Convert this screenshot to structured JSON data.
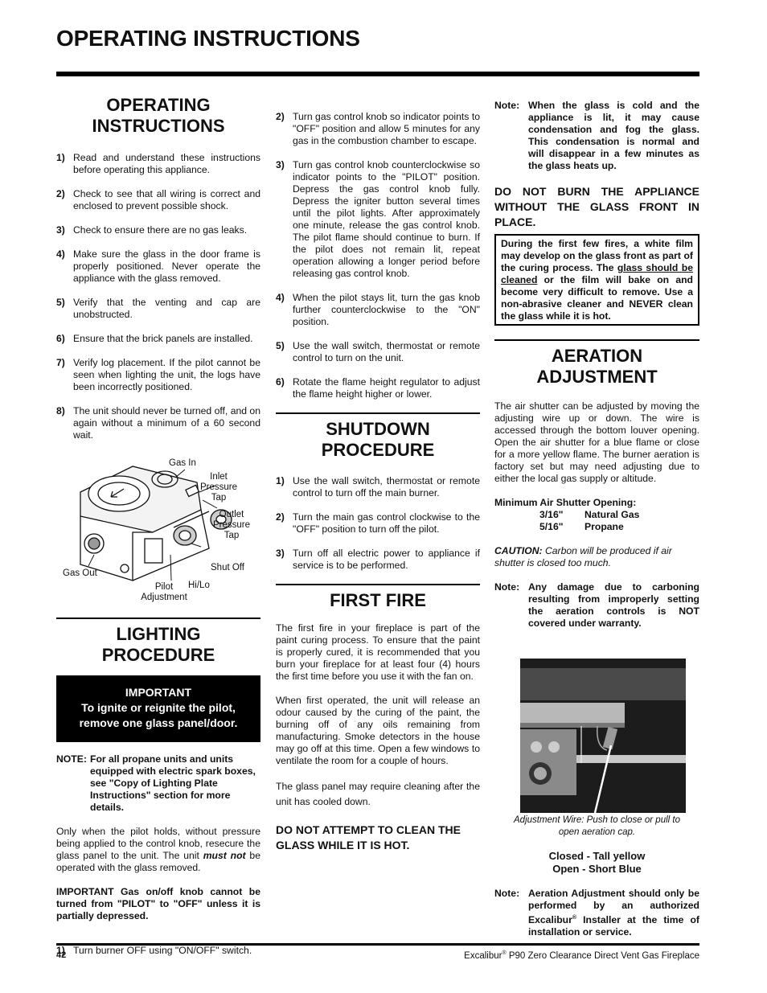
{
  "header": {
    "title": "OPERATING INSTRUCTIONS"
  },
  "operating": {
    "heading_line1": "OPERATING",
    "heading_line2": "INSTRUCTIONS",
    "items": [
      {
        "num": "1)",
        "text": "Read and understand these instructions before operating this appliance."
      },
      {
        "num": "2)",
        "text": "Check to see that all wiring is correct and enclosed to prevent possible shock."
      },
      {
        "num": "3)",
        "text": "Check to ensure there are no gas leaks."
      },
      {
        "num": "4)",
        "text": "Make sure the glass in the door frame is properly positioned. Never operate the appliance with the glass removed."
      },
      {
        "num": "5)",
        "text": "Verify that the venting and cap are unobstructed."
      },
      {
        "num": "6)",
        "text": "Ensure that the brick panels are installed."
      },
      {
        "num": "7)",
        "text": "Verify log placement. If the pilot cannot be seen when lighting the unit, the logs have been incorrectly positioned."
      },
      {
        "num": "8)",
        "text": "The unit should never be turned off, and on again without a minimum of a 60 second wait."
      }
    ]
  },
  "valve_diagram": {
    "labels": {
      "gas_in": "Gas In",
      "inlet_pressure_tap": "Inlet Pressure Tap",
      "outlet_pressure_tap": "Outlet Pressure Tap",
      "shut_off": "Shut Off",
      "gas_out": "Gas Out",
      "hi_lo": "Hi/Lo",
      "pilot_adjustment": "Pilot Adjustment"
    }
  },
  "lighting": {
    "heading_line1": "LIGHTING",
    "heading_line2": "PROCEDURE",
    "important_title": "IMPORTANT",
    "important_line1": "To ignite or reignite the pilot,",
    "important_line2": "remove one glass panel/door.",
    "note_label": "NOTE:",
    "note_text": "For all propane units and units equipped with electric spark boxes, see \"Copy of Lighting Plate Instructions\" section for more details.",
    "para1_a": "Only when the pilot holds, without pressure being applied to the control knob, resecure the glass panel to the unit. The unit ",
    "para1_em": "must not",
    "para1_b": " be operated with the glass removed.",
    "important_para": "IMPORTANT Gas on/off knob cannot be turned from \"PILOT\" to \"OFF\" unless it is partially depressed.",
    "items": [
      {
        "num": "1)",
        "text": "Turn burner OFF using \"ON/OFF\" switch."
      },
      {
        "num": "2)",
        "text": "Turn gas control knob so indicator points to \"OFF\" position and allow 5 minutes for any gas in the combustion chamber to escape."
      },
      {
        "num": "3)",
        "text": "Turn gas control knob counterclockwise so indicator points to the \"PILOT\" position. Depress the gas control knob fully. Depress the igniter button several times until the pilot lights. After approximately one minute, release the gas control knob. The pilot flame should continue to burn. If the pilot does not remain lit, repeat operation allowing a longer period before releasing gas control knob."
      },
      {
        "num": "4)",
        "text": "When the pilot stays lit, turn the gas knob further counterclockwise to the \"ON\" position."
      },
      {
        "num": "5)",
        "text": "Use the wall switch, thermostat or remote control to turn on the unit."
      },
      {
        "num": "6)",
        "text": "Rotate the flame height regulator to adjust the flame height higher or lower."
      }
    ]
  },
  "shutdown": {
    "heading_line1": "SHUTDOWN",
    "heading_line2": "PROCEDURE",
    "items": [
      {
        "num": "1)",
        "text": "Use the wall switch, thermostat or remote control to turn off the main burner."
      },
      {
        "num": "2)",
        "text": "Turn the main gas control clockwise to the \"OFF\" position to turn off the pilot."
      },
      {
        "num": "3)",
        "text": "Turn off all electric power to appliance if service is to be performed."
      }
    ]
  },
  "first_fire": {
    "heading": "FIRST FIRE",
    "para1": "The first fire in your fireplace is part of the paint curing process. To ensure that the paint is properly cured, it is recommended that you burn your fireplace for at least four (4) hours the first time before you use it with the fan on.",
    "para2": "When first operated, the unit will release an odour caused by the curing of the paint, the burning off of any oils remaining from manufacturing. Smoke detectors in the house may go off at this time. Open a few windows to ventilate the room for a couple of hours.",
    "para3": "The glass panel may require cleaning after the unit has cooled down.",
    "warning": "DO NOT ATTEMPT TO CLEAN THE GLASS WHILE IT IS HOT.",
    "note_label": "Note:",
    "note_text": "When the glass is cold and the appliance is lit, it may cause condensation and fog the glass. This condensation is normal and will disappear in a few minutes as the glass heats up.",
    "warning2": "DO NOT BURN THE APPLIANCE WITHOUT THE GLASS FRONT IN PLACE.",
    "box_a": "During the first few fires, a white film may develop on the glass front as part of the curing process. The ",
    "box_u": "glass should be cleaned",
    "box_b": " or the film will bake on and become very difficult to remove. Use a non-abrasive cleaner and NEVER clean the glass while it is hot."
  },
  "aeration": {
    "heading_line1": "AERATION",
    "heading_line2": "ADJUSTMENT",
    "para": "The air shutter can be adjusted by moving the adjusting wire up or down. The wire is accessed through the bottom louver opening. Open the air shutter for a blue flame or close for a more yellow flame. The burner aeration is factory set but may need adjusting due to either the local gas supply or altitude.",
    "min_title": "Minimum Air Shutter Opening:",
    "specs": [
      {
        "size": "3/16\"",
        "fuel": "Natural Gas"
      },
      {
        "size": "5/16\"",
        "fuel": "Propane"
      }
    ],
    "caution_label": "CAUTION:",
    "caution_text": " Carbon will be produced if air shutter is closed too much.",
    "note1_label": "Note:",
    "note1_text": "Any damage due to carboning resulting from improperly setting the aeration controls is NOT covered under warranty.",
    "caption": "Adjustment Wire: Push to close or pull to open aeration cap.",
    "closed": "Closed - Tall yellow",
    "open": "Open - Short Blue",
    "note2_label": "Note:",
    "note2_a": "Aeration Adjustment should only be performed by an authorized Excalibur",
    "note2_sup": "®",
    "note2_b": " Installer at the time of installation or service."
  },
  "footer": {
    "page_number": "42",
    "product_a": "Excalibur",
    "product_sup": "®",
    "product_b": " P90 Zero Clearance Direct Vent Gas Fireplace"
  }
}
